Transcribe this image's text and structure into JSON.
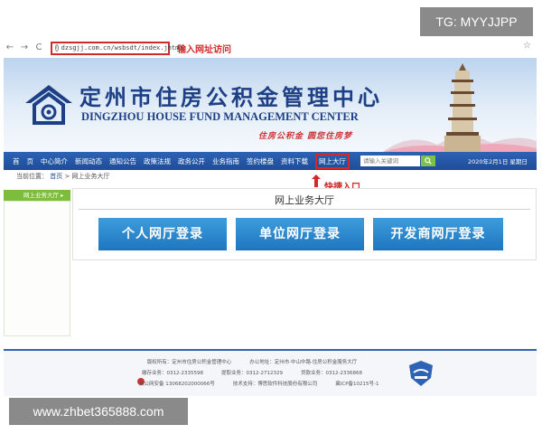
{
  "overlay": {
    "tag": "TG: MYYJJPP",
    "url": "www.zhbet365888.com"
  },
  "browser": {
    "back": "←",
    "forward": "→",
    "reload": "C",
    "address": "dzsgjj.com.cn/wsbsdt/index.jhtml",
    "address_note": "输入网址访问",
    "star": "☆"
  },
  "banner": {
    "title_cn": "定州市住房公积金管理中心",
    "title_en": "DINGZHOU HOUSE FUND MANAGEMENT CENTER",
    "slogan": "住房公积金  圆您住房梦"
  },
  "nav": {
    "items": [
      "首",
      "页",
      "中心简介",
      "新闻动态",
      "通知公告",
      "政策法规",
      "政务公开",
      "业务指南",
      "签约楼盘",
      "资料下载",
      "网上大厅"
    ],
    "search_placeholder": "请输入关键词",
    "date": "2020年2月1日 星期日"
  },
  "annotation": {
    "entry_label": "快捷入口"
  },
  "breadcrumb": {
    "prefix": "当前位置：",
    "home": "首页",
    "current": "> 网上业务大厅"
  },
  "sidebar": {
    "tab_label": "网上业务大厅 ▸"
  },
  "main": {
    "title": "网上业务大厅",
    "buttons": {
      "personal": "个人网厅登录",
      "unit": "单位网厅登录",
      "developer": "开发商网厅登录"
    }
  },
  "footer": {
    "row1": [
      "版权所有：定州市住房公积金管理中心",
      "办公地址：定州市·中山中路·住房公积金服务大厅"
    ],
    "row2": [
      "缴存业务：0312-2335598",
      "提取业务：0312-2712329",
      "贷款业务：0312-2336868"
    ],
    "row3": [
      "冀公网安备 13068202000066号",
      "技术支持：博思软件科技股份有限公司",
      "冀ICP备10215号-1"
    ]
  },
  "colors": {
    "nav_blue": "#1d4d9a",
    "annotation_red": "#d12a2a",
    "sidebar_green": "#7cbd3c",
    "button_blue": "#1f76bf"
  }
}
